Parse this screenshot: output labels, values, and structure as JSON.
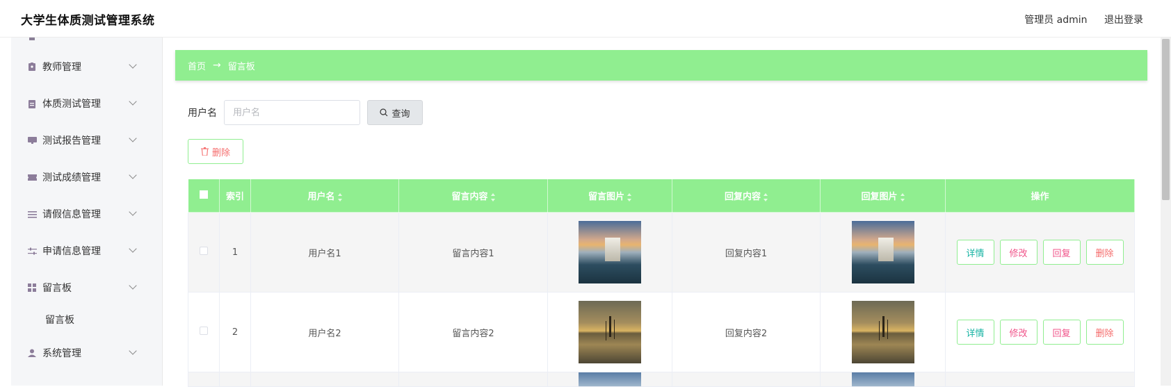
{
  "header": {
    "app_title": "大学生体质测试管理系统",
    "admin_label": "管理员 admin",
    "logout_label": "退出登录"
  },
  "sidebar": {
    "items": [
      {
        "label": "教师管理",
        "icon": "badge-icon"
      },
      {
        "label": "体质测试管理",
        "icon": "clipboard-icon"
      },
      {
        "label": "测试报告管理",
        "icon": "monitor-icon"
      },
      {
        "label": "测试成绩管理",
        "icon": "ticket-icon"
      },
      {
        "label": "请假信息管理",
        "icon": "list-icon"
      },
      {
        "label": "申请信息管理",
        "icon": "sliders-icon"
      },
      {
        "label": "留言板",
        "icon": "grid-icon"
      },
      {
        "label": "系统管理",
        "icon": "user-icon"
      }
    ],
    "sub_item": "留言板"
  },
  "breadcrumb": {
    "home": "首页",
    "arrow": "→",
    "current": "留言板"
  },
  "search": {
    "label": "用户名",
    "placeholder": "用户名",
    "query_button": "查询"
  },
  "toolbar": {
    "delete_button": "删除"
  },
  "table": {
    "columns": [
      "索引",
      "用户名",
      "留言内容",
      "留言图片",
      "回复内容",
      "回复图片",
      "操作"
    ],
    "rows": [
      {
        "index": "1",
        "username": "用户名1",
        "message": "留言内容1",
        "reply": "回复内容1"
      },
      {
        "index": "2",
        "username": "用户名2",
        "message": "留言内容2",
        "reply": "回复内容2"
      }
    ],
    "actions": {
      "detail": "详情",
      "edit": "修改",
      "reply": "回复",
      "remove": "删除"
    }
  },
  "colors": {
    "accent": "#90ee90",
    "danger": "#f56c6c",
    "detail": "#17b3a3",
    "edit": "#f0548a"
  }
}
